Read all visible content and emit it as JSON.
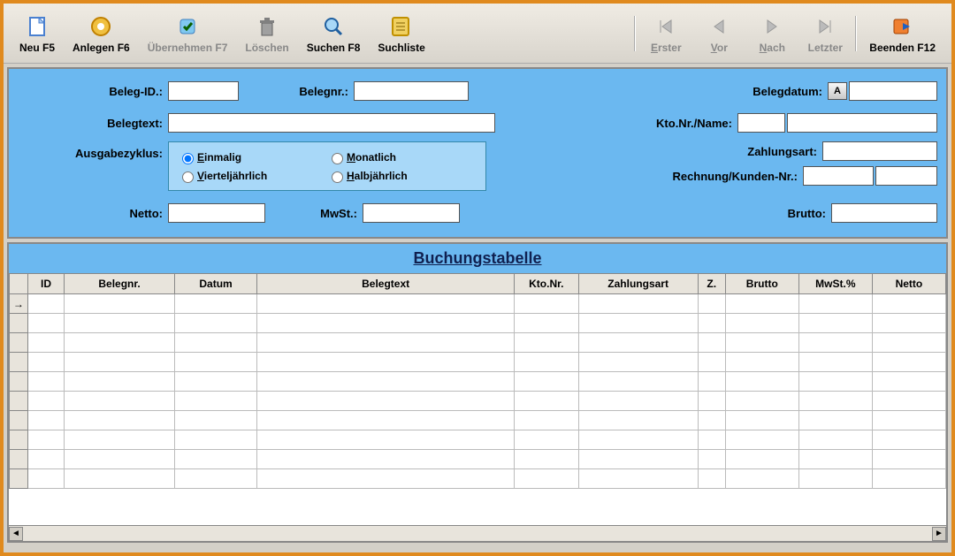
{
  "toolbar": {
    "neu": "Neu F5",
    "anlegen": "Anlegen F6",
    "uebernehmen": "Übernehmen F7",
    "loeschen": "Löschen",
    "suchen": "Suchen F8",
    "suchliste": "Suchliste",
    "erster": "Erster",
    "vor": "Vor",
    "nach": "Nach",
    "letzter": "Letzter",
    "beenden": "Beenden F12"
  },
  "form": {
    "beleg_id_label": "Beleg-ID.:",
    "beleg_id_value": "",
    "belegnr_label": "Belegnr.:",
    "belegnr_value": "",
    "belegdatum_label": "Belegdatum:",
    "belegdatum_btn": "A",
    "belegdatum_value": "",
    "belegtext_label": "Belegtext:",
    "belegtext_value": "",
    "kto_label": "Kto.Nr./Name:",
    "kto_nr_value": "",
    "kto_name_value": "",
    "zyklus_label": "Ausgabezyklus:",
    "zyklus_einmalig": "Einmalig",
    "zyklus_monatlich": "Monatlich",
    "zyklus_viertel": "Vierteljährlich",
    "zyklus_halb": "Halbjährlich",
    "zyklus_selected": "einmalig",
    "zahlungsart_label": "Zahlungsart:",
    "zahlungsart_value": "",
    "rechnung_label": "Rechnung/Kunden-Nr.:",
    "rechnung_value": "",
    "rechnung2_value": "",
    "netto_label": "Netto:",
    "netto_value": "",
    "mwst_label": "MwSt.:",
    "mwst_value": "",
    "brutto_label": "Brutto:",
    "brutto_value": ""
  },
  "grid": {
    "title": "Buchungstabelle",
    "columns": {
      "rowsel": "",
      "id": "ID",
      "belegnr": "Belegnr.",
      "datum": "Datum",
      "belegtext": "Belegtext",
      "ktonr": "Kto.Nr.",
      "zahlungsart": "Zahlungsart",
      "z": "Z.",
      "brutto": "Brutto",
      "mwstp": "MwSt.%",
      "netto": "Netto"
    },
    "empty_rows": 10,
    "current_row_marker": "→"
  }
}
